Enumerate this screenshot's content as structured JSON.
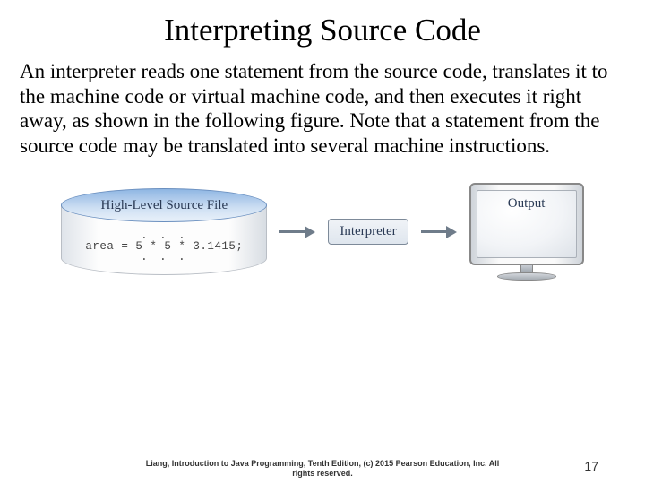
{
  "title": "Interpreting Source Code",
  "body": "An interpreter reads one statement from the source code, translates it to the machine code or virtual machine code, and then executes it right away, as shown in the following figure. Note that a statement from the source code may be translated into several machine instructions.",
  "figure": {
    "source_label": "High-Level Source File",
    "dots": ". . .",
    "code_line": "area = 5 * 5 * 3.1415;",
    "interpreter_label": "Interpreter",
    "output_label": "Output"
  },
  "footer": {
    "line1": "Liang, Introduction to Java Programming, Tenth Edition, (c) 2015 Pearson Education, Inc. All",
    "line2": "rights reserved."
  },
  "page_number": "17"
}
